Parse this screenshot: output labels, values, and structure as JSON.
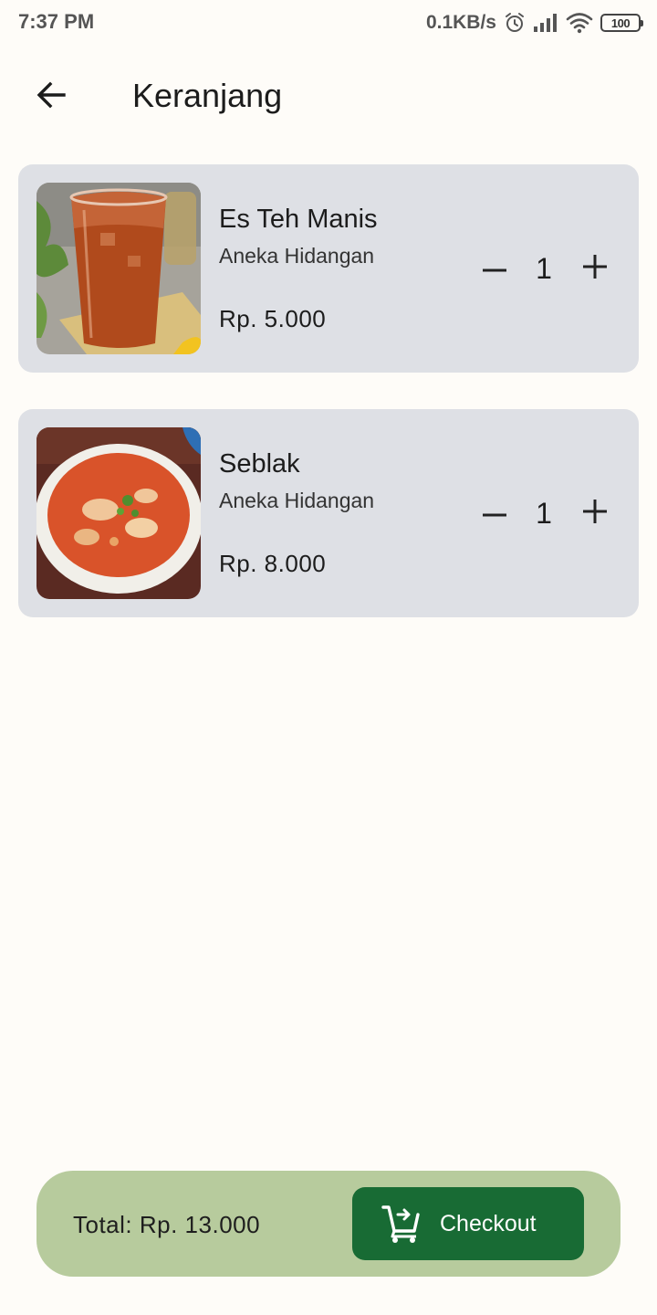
{
  "status_bar": {
    "time": "7:37 PM",
    "net_speed": "0.1KB/s",
    "battery": "100",
    "icons": [
      "alarm-icon",
      "signal-icon",
      "wifi-icon",
      "battery-icon"
    ]
  },
  "app_bar": {
    "back_icon": "arrow-left-icon",
    "title": "Keranjang"
  },
  "cart_items": [
    {
      "name": "Es Teh Manis",
      "category": "Aneka Hidangan",
      "price": "Rp. 5.000",
      "quantity": "1",
      "image": "iced-tea-photo"
    },
    {
      "name": "Seblak",
      "category": "Aneka Hidangan",
      "price": "Rp. 8.000",
      "quantity": "1",
      "image": "seblak-bowl-photo"
    }
  ],
  "bottom_bar": {
    "total": "Total:  Rp. 13.000",
    "checkout_label": "Checkout",
    "checkout_icon": "cart-checkout-icon"
  },
  "colors": {
    "background": "#fefcf8",
    "card": "#dee0e5",
    "bottom_bar": "#b7cb9d",
    "checkout_button": "#186b34"
  }
}
